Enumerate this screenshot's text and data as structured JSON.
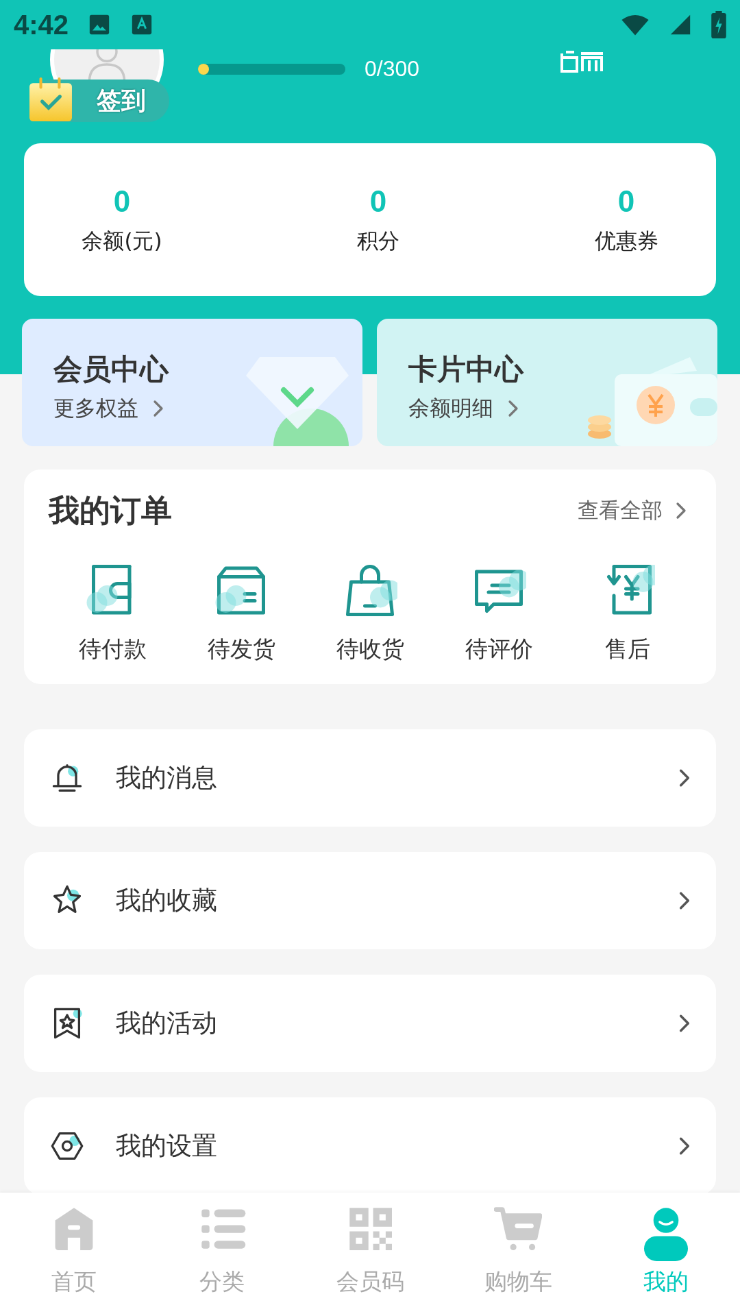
{
  "status_bar": {
    "time": "4:42"
  },
  "profile": {
    "progress": {
      "level": 0,
      "reading": "0/300"
    },
    "sign_in": {
      "label": "签到"
    }
  },
  "stats": [
    {
      "value": "0",
      "label": "余额(元)"
    },
    {
      "value": "0",
      "label": "积分"
    },
    {
      "value": "0",
      "label": "优惠券"
    }
  ],
  "promo_cards": [
    {
      "kind": "member",
      "title": "会员中心",
      "link": "更多权益"
    },
    {
      "kind": "card",
      "title": "卡片中心",
      "link": "余额明细"
    }
  ],
  "orders": {
    "title": "我的订单",
    "view_all": "查看全部",
    "items": [
      {
        "kind": "wallet",
        "label": "待付款"
      },
      {
        "kind": "box",
        "label": "待发货"
      },
      {
        "kind": "bag",
        "label": "待收货"
      },
      {
        "kind": "chat",
        "label": "待评价"
      },
      {
        "kind": "refund",
        "label": "售后"
      }
    ]
  },
  "menu": [
    {
      "kind": "bell",
      "label": "我的消息"
    },
    {
      "kind": "star",
      "label": "我的收藏"
    },
    {
      "kind": "bookmark",
      "label": "我的活动"
    },
    {
      "kind": "settings",
      "label": "我的设置"
    }
  ],
  "tab_bar": [
    {
      "kind": "home",
      "label": "首页",
      "selected": false
    },
    {
      "kind": "list",
      "label": "分类",
      "selected": false
    },
    {
      "kind": "qr",
      "label": "会员码",
      "selected": false
    },
    {
      "kind": "cart",
      "label": "购物车",
      "selected": false
    },
    {
      "kind": "user",
      "label": "我的",
      "selected": true
    }
  ]
}
